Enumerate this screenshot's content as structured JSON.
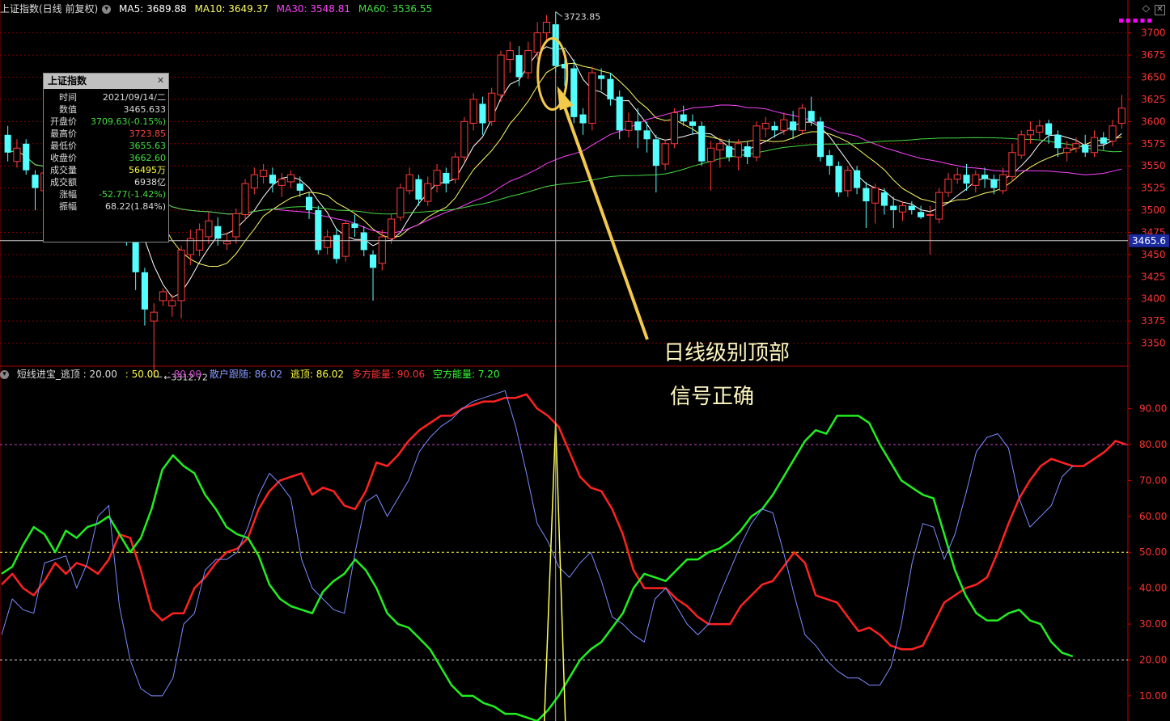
{
  "main_chart": {
    "title": "上证指数(日线 前复权)",
    "ma": [
      {
        "label": "MA5: 3689.88",
        "color": "#ffffff"
      },
      {
        "label": "MA10: 3649.37",
        "color": "#ffff66"
      },
      {
        "label": "MA30: 3548.81",
        "color": "#ff44ff"
      },
      {
        "label": "MA60: 3536.55",
        "color": "#44dd44"
      }
    ],
    "price_axis": [
      "3700",
      "3675",
      "3650",
      "3625",
      "3600",
      "3575",
      "3550",
      "3525",
      "3500",
      "3475",
      "3450",
      "3425",
      "3400",
      "3375",
      "3350"
    ],
    "price_range": [
      3325,
      3717
    ],
    "current_price": "3465.6",
    "current_price_value": 3465.6,
    "high_label": "3723.85",
    "low_label": "3312.72"
  },
  "info_panel": {
    "title": "上证指数",
    "rows": [
      {
        "label": "时间",
        "value": "2021/09/14/二",
        "color": "#dddddd"
      },
      {
        "label": "数值",
        "value": "3465.633",
        "color": "#dddddd"
      },
      {
        "label": "开盘价",
        "value": "3709.63(-0.15%)",
        "color": "#44dd44"
      },
      {
        "label": "最高价",
        "value": "3723.85",
        "color": "#ff4444"
      },
      {
        "label": "最低价",
        "value": "3655.63",
        "color": "#44dd44"
      },
      {
        "label": "收盘价",
        "value": "3662.60",
        "color": "#44dd44"
      },
      {
        "label": "成交量",
        "value": "56495万",
        "color": "#ffff44"
      },
      {
        "label": "成交额",
        "value": "6938亿",
        "color": "#dddddd"
      },
      {
        "label": "涨幅",
        "value": "-52.77(-1.42%)",
        "color": "#44dd44"
      },
      {
        "label": "振幅",
        "value": "68.22(1.84%)",
        "color": "#dddddd"
      }
    ]
  },
  "indicator": {
    "name": "短线进宝_逃顶",
    "params": [
      {
        "label": ": 20.00",
        "color": "#dddddd"
      },
      {
        "label": ": 50.00",
        "color": "#ffff44"
      },
      {
        "label": ": 80.00",
        "color": "#cc44cc"
      },
      {
        "label": "散户跟随: 86.02",
        "color": "#8899ff"
      },
      {
        "label": "逃顶: 86.02",
        "color": "#ffff44"
      },
      {
        "label": "多方能量: 90.06",
        "color": "#ff3333"
      },
      {
        "label": "空方能量: 7.20",
        "color": "#33ff33"
      }
    ],
    "axis": [
      "90.00",
      "80.00",
      "70.00",
      "60.00",
      "50.00",
      "40.00",
      "30.00",
      "20.00",
      "10.00"
    ]
  },
  "annotations": {
    "line1": "日线级别顶部",
    "line2": "信号正确"
  },
  "colors": {
    "up": "#ff3b3b",
    "down": "#54ffff",
    "axis_text": "#ff3333",
    "grid": "#800000"
  },
  "chart_data": {
    "type": "candlestick",
    "candles": [
      [
        3585,
        3565,
        3595,
        3555
      ],
      [
        3555,
        3570,
        3580,
        3548
      ],
      [
        3575,
        3545,
        3580,
        3540
      ],
      [
        3540,
        3525,
        3545,
        3500
      ],
      [
        3522,
        3542,
        3552,
        3515
      ],
      [
        3540,
        3530,
        3560,
        3525
      ],
      [
        3525,
        3515,
        3535,
        3505
      ],
      [
        3520,
        3540,
        3550,
        3512
      ],
      [
        3540,
        3580,
        3595,
        3535
      ],
      [
        3575,
        3585,
        3595,
        3560
      ],
      [
        3580,
        3550,
        3590,
        3540
      ],
      [
        3545,
        3530,
        3555,
        3520
      ],
      [
        3525,
        3515,
        3530,
        3495
      ],
      [
        3510,
        3470,
        3520,
        3460
      ],
      [
        3470,
        3430,
        3475,
        3410
      ],
      [
        3430,
        3388,
        3435,
        3370
      ],
      [
        3375,
        3385,
        3395,
        3312
      ],
      [
        3398,
        3408,
        3412,
        3392
      ],
      [
        3392,
        3398,
        3405,
        3380
      ],
      [
        3398,
        3455,
        3460,
        3378
      ],
      [
        3450,
        3468,
        3478,
        3438
      ],
      [
        3455,
        3478,
        3485,
        3448
      ],
      [
        3470,
        3488,
        3498,
        3462
      ],
      [
        3482,
        3468,
        3492,
        3460
      ],
      [
        3462,
        3465,
        3475,
        3455
      ],
      [
        3470,
        3496,
        3502,
        3462
      ],
      [
        3495,
        3530,
        3535,
        3488
      ],
      [
        3525,
        3540,
        3548,
        3518
      ],
      [
        3538,
        3545,
        3552,
        3530
      ],
      [
        3540,
        3530,
        3548,
        3520
      ],
      [
        3528,
        3535,
        3542,
        3515
      ],
      [
        3532,
        3540,
        3545,
        3525
      ],
      [
        3530,
        3522,
        3538,
        3515
      ],
      [
        3515,
        3500,
        3520,
        3490
      ],
      [
        3500,
        3455,
        3505,
        3450
      ],
      [
        3458,
        3470,
        3478,
        3450
      ],
      [
        3472,
        3445,
        3480,
        3440
      ],
      [
        3448,
        3485,
        3488,
        3442
      ],
      [
        3485,
        3480,
        3495,
        3470
      ],
      [
        3475,
        3455,
        3482,
        3448
      ],
      [
        3450,
        3435,
        3455,
        3398
      ],
      [
        3440,
        3470,
        3478,
        3432
      ],
      [
        3468,
        3490,
        3496,
        3462
      ],
      [
        3492,
        3525,
        3530,
        3488
      ],
      [
        3522,
        3540,
        3548,
        3518
      ],
      [
        3535,
        3512,
        3540,
        3505
      ],
      [
        3510,
        3530,
        3538,
        3505
      ],
      [
        3528,
        3545,
        3552,
        3520
      ],
      [
        3542,
        3530,
        3548,
        3520
      ],
      [
        3535,
        3560,
        3565,
        3530
      ],
      [
        3560,
        3600,
        3605,
        3555
      ],
      [
        3598,
        3625,
        3632,
        3590
      ],
      [
        3620,
        3598,
        3628,
        3585
      ],
      [
        3600,
        3632,
        3638,
        3595
      ],
      [
        3630,
        3675,
        3680,
        3622
      ],
      [
        3670,
        3680,
        3690,
        3655
      ],
      [
        3675,
        3650,
        3685,
        3640
      ],
      [
        3655,
        3680,
        3690,
        3648
      ],
      [
        3678,
        3700,
        3712,
        3670
      ],
      [
        3700,
        3712,
        3720,
        3690
      ],
      [
        3709.63,
        3662.6,
        3723.85,
        3655.63
      ],
      [
        3665,
        3660,
        3680,
        3640
      ],
      [
        3660,
        3605,
        3670,
        3598
      ],
      [
        3608,
        3598,
        3615,
        3585
      ],
      [
        3598,
        3655,
        3662,
        3590
      ],
      [
        3652,
        3648,
        3660,
        3635
      ],
      [
        3648,
        3625,
        3655,
        3618
      ],
      [
        3628,
        3590,
        3635,
        3580
      ],
      [
        3590,
        3600,
        3610,
        3582
      ],
      [
        3600,
        3590,
        3615,
        3570
      ],
      [
        3590,
        3580,
        3600,
        3565
      ],
      [
        3580,
        3550,
        3585,
        3520
      ],
      [
        3552,
        3575,
        3580,
        3545
      ],
      [
        3575,
        3610,
        3615,
        3570
      ],
      [
        3608,
        3600,
        3618,
        3595
      ],
      [
        3600,
        3595,
        3608,
        3585
      ],
      [
        3595,
        3555,
        3600,
        3550
      ],
      [
        3555,
        3570,
        3578,
        3522
      ],
      [
        3568,
        3575,
        3582,
        3548
      ],
      [
        3572,
        3560,
        3580,
        3555
      ],
      [
        3560,
        3575,
        3580,
        3545
      ],
      [
        3572,
        3560,
        3578,
        3552
      ],
      [
        3560,
        3595,
        3600,
        3555
      ],
      [
        3592,
        3598,
        3605,
        3582
      ],
      [
        3595,
        3590,
        3600,
        3582
      ],
      [
        3590,
        3602,
        3610,
        3585
      ],
      [
        3600,
        3590,
        3612,
        3580
      ],
      [
        3590,
        3615,
        3620,
        3585
      ],
      [
        3612,
        3600,
        3628,
        3595
      ],
      [
        3600,
        3560,
        3605,
        3555
      ],
      [
        3562,
        3550,
        3568,
        3540
      ],
      [
        3550,
        3520,
        3555,
        3515
      ],
      [
        3522,
        3545,
        3550,
        3515
      ],
      [
        3545,
        3525,
        3550,
        3518
      ],
      [
        3525,
        3510,
        3532,
        3480
      ],
      [
        3508,
        3525,
        3530,
        3485
      ],
      [
        3520,
        3505,
        3525,
        3495
      ],
      [
        3505,
        3500,
        3515,
        3480
      ],
      [
        3498,
        3505,
        3510,
        3488
      ],
      [
        3505,
        3500,
        3510,
        3495
      ],
      [
        3498,
        3492,
        3505,
        3490
      ],
      [
        3495,
        3495,
        3505,
        3450
      ],
      [
        3490,
        3520,
        3525,
        3485
      ],
      [
        3520,
        3535,
        3542,
        3515
      ],
      [
        3535,
        3540,
        3548,
        3530
      ],
      [
        3540,
        3530,
        3552,
        3522
      ],
      [
        3528,
        3540,
        3545,
        3520
      ],
      [
        3540,
        3535,
        3548,
        3525
      ],
      [
        3535,
        3525,
        3540,
        3518
      ],
      [
        3522,
        3540,
        3548,
        3518
      ],
      [
        3538,
        3565,
        3575,
        3532
      ],
      [
        3562,
        3585,
        3590,
        3558
      ],
      [
        3585,
        3590,
        3600,
        3575
      ],
      [
        3588,
        3595,
        3602,
        3580
      ],
      [
        3598,
        3585,
        3602,
        3575
      ],
      [
        3585,
        3570,
        3590,
        3560
      ],
      [
        3565,
        3570,
        3578,
        3555
      ],
      [
        3570,
        3575,
        3582,
        3565
      ],
      [
        3574,
        3565,
        3585,
        3560
      ],
      [
        3565,
        3582,
        3590,
        3560
      ],
      [
        3582,
        3575,
        3588,
        3568
      ],
      [
        3578,
        3595,
        3602,
        3572
      ],
      [
        3598,
        3615,
        3630,
        3592
      ]
    ],
    "indicator_range": [
      3,
      98
    ],
    "indicator_series": [
      {
        "key": "bull",
        "color": "#ff2222",
        "values": [
          41,
          44,
          40,
          38,
          42,
          47,
          44,
          47,
          46,
          44,
          48,
          55,
          54,
          45,
          34,
          31,
          33,
          33,
          40,
          43,
          47,
          50,
          51,
          54,
          62,
          67,
          70,
          71,
          72,
          66,
          68,
          67,
          63,
          62,
          67,
          75,
          74,
          77,
          81,
          84,
          86,
          88,
          88,
          90,
          91,
          92,
          92,
          93,
          93,
          94,
          90,
          88,
          85,
          78,
          71,
          68,
          67,
          62,
          55,
          45,
          40,
          40,
          40,
          37,
          35,
          32,
          30,
          30,
          30,
          35,
          38,
          41,
          42,
          46,
          50,
          47,
          38,
          37,
          36,
          32,
          28,
          29,
          27,
          24,
          23,
          23,
          24,
          30,
          36,
          38,
          40,
          41,
          43,
          50,
          58,
          65,
          70,
          74,
          76,
          75,
          74,
          74,
          76,
          78,
          81,
          80
        ]
      },
      {
        "key": "bear",
        "color": "#22ee22",
        "values": [
          44,
          46,
          52,
          57,
          55,
          50,
          56,
          54,
          57,
          58,
          60,
          55,
          50,
          54,
          62,
          73,
          77,
          74,
          72,
          66,
          62,
          57,
          55,
          54,
          49,
          41,
          37,
          35,
          34,
          33,
          39,
          42,
          44,
          48,
          45,
          40,
          33,
          30,
          29,
          26,
          23,
          18,
          13,
          10,
          10,
          8,
          7,
          5,
          5,
          4,
          3,
          6,
          10,
          15,
          20,
          23,
          25,
          29,
          33,
          40,
          44,
          43,
          42,
          45,
          48,
          48,
          50,
          51,
          53,
          56,
          60,
          62,
          66,
          71,
          76,
          81,
          84,
          83,
          88,
          88,
          88,
          86,
          80,
          75,
          70,
          68,
          66,
          65,
          55,
          45,
          38,
          33,
          31,
          31,
          33,
          34,
          31,
          30,
          25,
          22,
          21
        ]
      },
      {
        "key": "retail",
        "color": "#7c8cff",
        "values": [
          27,
          37,
          34,
          33,
          47,
          48,
          49,
          40,
          47,
          60,
          63,
          35,
          20,
          12,
          10,
          10,
          15,
          30,
          33,
          45,
          48,
          48,
          50,
          57,
          66,
          72,
          69,
          65,
          48,
          40,
          37,
          34,
          33,
          50,
          64,
          66,
          60,
          65,
          70,
          78,
          82,
          85,
          87,
          90,
          92,
          93,
          94,
          95,
          85,
          72,
          58,
          53,
          46,
          43,
          47,
          50,
          42,
          32,
          30,
          27,
          25,
          37,
          40,
          35,
          30,
          27,
          30,
          38,
          45,
          52,
          58,
          62,
          61,
          50,
          38,
          27,
          24,
          20,
          17,
          15,
          15,
          13,
          13,
          18,
          30,
          47,
          58,
          57,
          48,
          55,
          66,
          78,
          82,
          83,
          79,
          65,
          57,
          60,
          63,
          71,
          74
        ]
      }
    ],
    "signal_series": [
      {
        "key": "escape_top",
        "color": "#ffff55",
        "peaks": [
          {
            "i": 47,
            "v": 86.02
          }
        ]
      }
    ]
  }
}
